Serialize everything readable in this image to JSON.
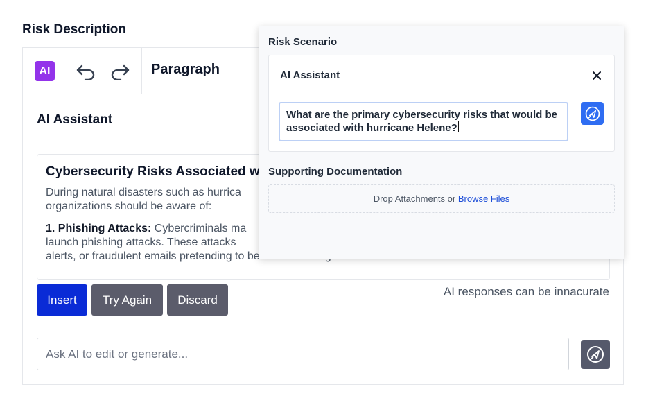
{
  "section_title": "Risk Description",
  "toolbar": {
    "ai_badge": "AI",
    "paragraph_label": "Paragraph"
  },
  "editor": {
    "ai_header": "AI Assistant",
    "response": {
      "title": "Cybersecurity Risks Associated w",
      "intro_line1": "During natural disasters such as hurrica",
      "intro_line2": "organizations should be aware of:",
      "item_bold": "1. Phishing Attacks:",
      "item_line1_rest": " Cybercriminals ma",
      "item_line2": "launch phishing attacks. These attacks",
      "item_line3": "alerts, or fraudulent emails pretending to be from relief organizations."
    },
    "buttons": {
      "insert": "Insert",
      "try_again": "Try Again",
      "discard": "Discard"
    },
    "disclaimer": "AI responses can be innacurate",
    "ask_placeholder": "Ask AI to edit or generate..."
  },
  "popover": {
    "title": "Risk Scenario",
    "assistant_title": "AI Assistant",
    "prompt_text": "What are the primary cybersecurity risks that would be associated with hurricane Helene?",
    "docs_title": "Supporting Documentation",
    "drop_text": "Drop Attachments or ",
    "browse_link": "Browse Files"
  },
  "icons": {
    "undo": "undo-icon",
    "redo": "redo-icon",
    "close": "close-icon",
    "send": "send-rocket-icon"
  },
  "colors": {
    "ai_badge": "#9333ea",
    "insert_button": "#0a2bd6",
    "secondary_button": "#5b5c6b",
    "send_blue": "#2f6df2",
    "link": "#1d4ed8"
  }
}
